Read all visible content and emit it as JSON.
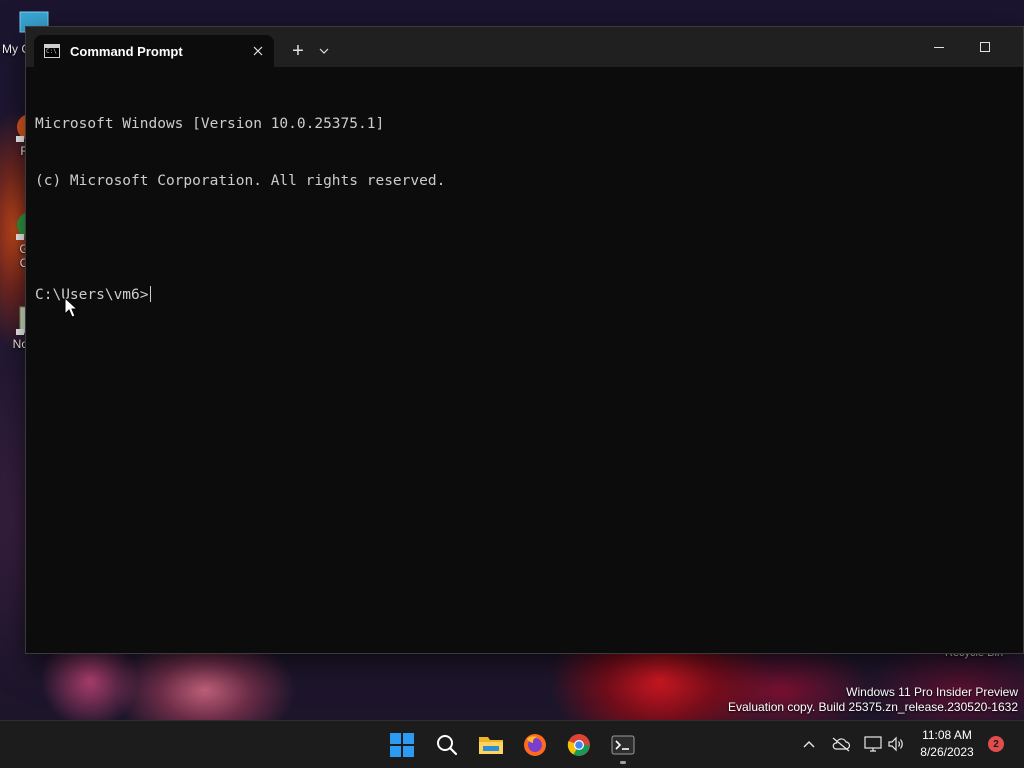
{
  "desktop": {
    "icons": [
      {
        "label": "My C",
        "icon": "computer-icon"
      },
      {
        "label": "F",
        "icon": "firefox-shortcut-icon"
      },
      {
        "label": "G",
        "icon": "chrome-shortcut-icon"
      },
      {
        "label": "C",
        "icon": "chrome-shortcut-icon"
      },
      {
        "label": "Not",
        "icon": "notepad-shortcut-icon"
      }
    ],
    "recycle_bin_label": "Recycle Bin",
    "watermark": {
      "line1": "Windows 11 Pro Insider Preview",
      "line2": "Evaluation copy. Build 25375.zn_release.230520-1632"
    }
  },
  "window": {
    "tab_title": "Command Prompt",
    "tab_icon_text": "C:\\",
    "new_tab_symbol": "+",
    "console_lines": [
      "Microsoft Windows [Version 10.0.25375.1]",
      "(c) Microsoft Corporation. All rights reserved.",
      "",
      "C:\\Users\\vm6>"
    ],
    "colors": {
      "background": "#0c0c0c",
      "titlebar": "#202020",
      "text": "#cccccc"
    }
  },
  "taskbar": {
    "apps": [
      {
        "name": "Start",
        "icon": "windows-logo-icon"
      },
      {
        "name": "Search",
        "icon": "search-icon"
      },
      {
        "name": "File Explorer",
        "icon": "folder-icon"
      },
      {
        "name": "Firefox",
        "icon": "firefox-icon"
      },
      {
        "name": "Google Chrome",
        "icon": "chrome-icon"
      },
      {
        "name": "Terminal",
        "icon": "terminal-icon",
        "running": true
      }
    ],
    "clock": {
      "time": "11:08 AM",
      "date": "8/26/2023"
    },
    "notification_count": "2",
    "accent": "#2b9cf2"
  }
}
